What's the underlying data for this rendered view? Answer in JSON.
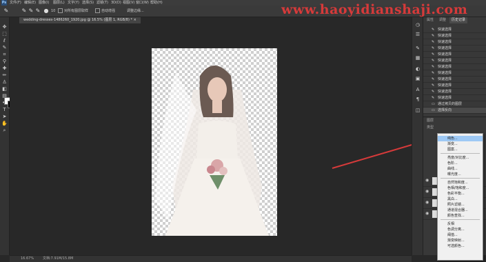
{
  "menubar": {
    "logo": "Ps",
    "items": [
      "文件(F)",
      "编辑(E)",
      "图像(I)",
      "图层(L)",
      "文字(Y)",
      "选择(S)",
      "滤镜(T)",
      "3D(D)",
      "视图(V)",
      "窗口(W)",
      "帮助(H)"
    ]
  },
  "options": {
    "size": "10",
    "sample_all": "对所有图层取样",
    "auto_enhance": "自动增强",
    "refine": "调整边缘..."
  },
  "document": {
    "tab_title": "wedding-dresses-1486260_1920.jpg @ 16.5% (图层 1, RGB/8) * ×"
  },
  "status": {
    "zoom": "16.67%",
    "doc_info": "文档:7.91M/15.8M"
  },
  "watermark": "www.haoyidianshaji.com",
  "panel": {
    "tabs": [
      "属性",
      "调整",
      "历史记录"
    ],
    "history_items": [
      "快速选择",
      "快速选择",
      "快速选择",
      "快速选择",
      "快速选择",
      "快速选择",
      "快速选择",
      "快速选择",
      "快速选择",
      "快速选择",
      "快速选择",
      "快速选择",
      "通过拷贝的图层",
      "选择反向"
    ],
    "layers_tab": "图层",
    "layer_kind": "类型"
  },
  "dropdown": {
    "items": [
      "纯色...",
      "渐变...",
      "图案...",
      "亮度/对比度...",
      "色阶...",
      "曲线...",
      "曝光度...",
      "自然饱和度...",
      "色相/饱和度...",
      "色彩平衡...",
      "黑白...",
      "照片滤镜...",
      "通道混合器...",
      "颜色查找...",
      "反相",
      "色调分离...",
      "阈值...",
      "渐变映射...",
      "可选颜色..."
    ],
    "highlighted_index": 0
  },
  "colors": {
    "arrow": "#d63a3a",
    "highlight": "#9ec9f5"
  }
}
